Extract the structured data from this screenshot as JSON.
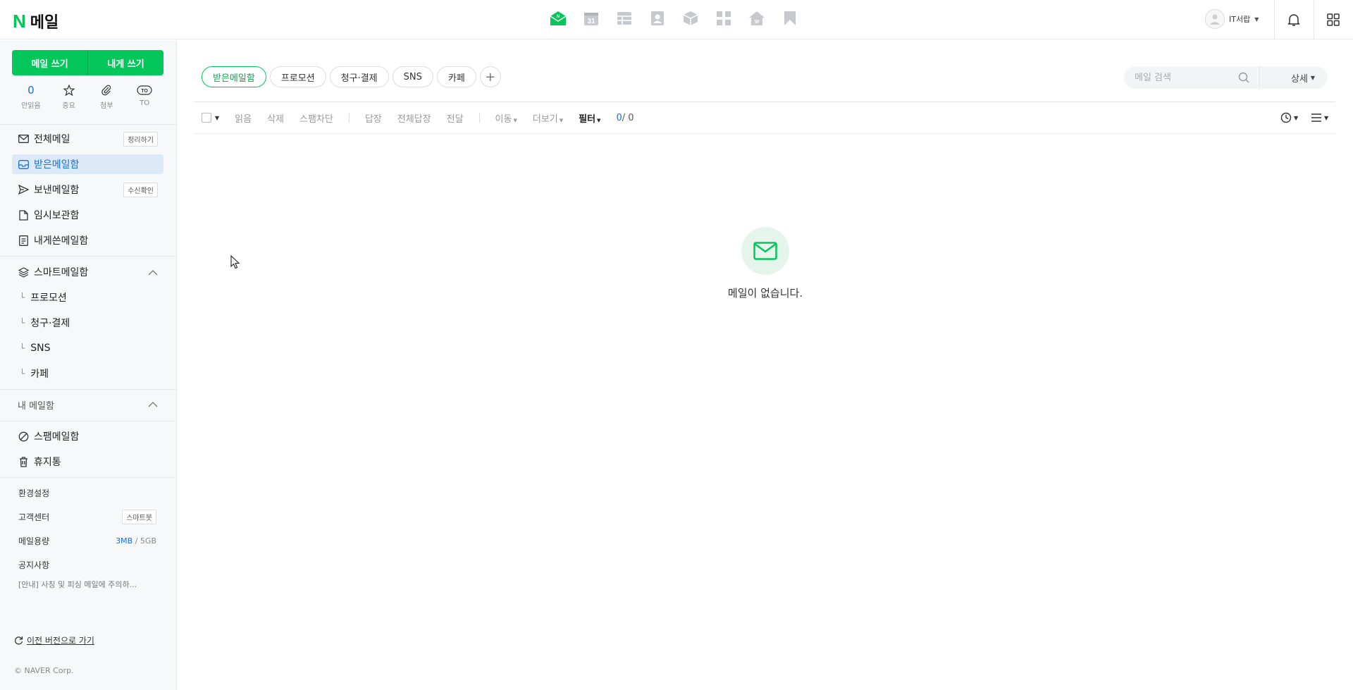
{
  "header": {
    "logo_n": "N",
    "logo_text": "메일",
    "apps": [
      "mail-icon",
      "calendar-icon",
      "table-icon",
      "contacts-icon",
      "box-icon",
      "grid-app-icon",
      "home-icon",
      "bookmark-icon"
    ],
    "calendar_num": "31",
    "user_name": "IT서랍",
    "brand_color": "#03c75a"
  },
  "sidebar": {
    "compose": {
      "write": "메일 쓰기",
      "self": "내게 쓰기"
    },
    "quick": [
      {
        "value": "0",
        "label": "안읽음"
      },
      {
        "icon": "star-icon",
        "label": "중요"
      },
      {
        "icon": "attachment-icon",
        "label": "첨부"
      },
      {
        "icon": "to-icon",
        "label": "TO"
      }
    ],
    "to_badge": "TO",
    "folders": [
      {
        "label": "전체메일",
        "tag": "정리하기"
      },
      {
        "label": "받은메일함"
      },
      {
        "label": "보낸메일함",
        "tag": "수신확인"
      },
      {
        "label": "임시보관함"
      },
      {
        "label": "내게쓴메일함"
      }
    ],
    "smart": {
      "label": "스마트메일함",
      "items": [
        "프로모션",
        "청구·결제",
        "SNS",
        "카페"
      ],
      "branch": "└"
    },
    "my_mailbox": "내 메일함",
    "extra": [
      {
        "label": "스팸메일함"
      },
      {
        "label": "휴지통"
      }
    ],
    "settings": "환경설정",
    "support": {
      "label": "고객센터",
      "tag": "스마트봇"
    },
    "capacity": {
      "label": "메일용량",
      "used": "3MB",
      "sep": "/",
      "total": "5GB"
    },
    "notice": {
      "label": "공지사항",
      "text": "[안내] 사칭 및 피싱 메일에 주의하..."
    },
    "prev_version": "이전 버전으로 가기",
    "copyright": "© NAVER Corp."
  },
  "main": {
    "chips": [
      "받은메일함",
      "프로모션",
      "청구·결제",
      "SNS",
      "카페"
    ],
    "add_chip": "+",
    "search_placeholder": "메일 검색",
    "detail": "상세",
    "toolbar": {
      "read": "읽음",
      "delete": "삭제",
      "spam": "스팸차단",
      "reply": "답장",
      "reply_all": "전체답장",
      "forward": "전달",
      "move": "이동",
      "more": "더보기",
      "filter": "필터",
      "count_current": "0",
      "count_total": "/ 0"
    },
    "empty_text": "메일이 없습니다."
  }
}
